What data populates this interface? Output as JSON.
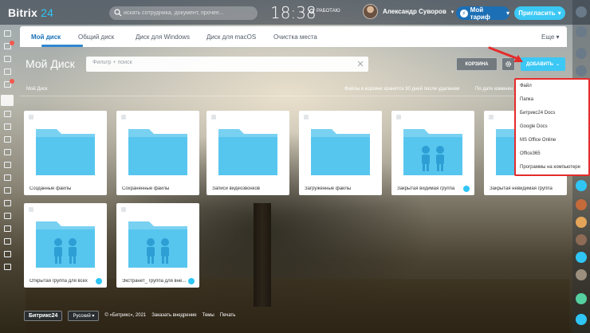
{
  "header": {
    "logo_word": "Bitrix",
    "logo_num": "24",
    "search_placeholder": "искать сотрудника, документ, прочее...",
    "clock": "18:38",
    "status": "РАБОТАЮ",
    "user_name": "Александр Суворов",
    "tariff_label": "Мой тариф",
    "invite_label": "Пригласить"
  },
  "tabs": [
    {
      "label": "Мой диск"
    },
    {
      "label": "Общий диск"
    },
    {
      "label": "Диск для Windows"
    },
    {
      "label": "Диск для macOS"
    },
    {
      "label": "Очистка места"
    }
  ],
  "more_label": "Еще",
  "toolbar": {
    "title": "Мой Диск",
    "filter_placeholder": "Фильтр + поиск",
    "trash_label": "КОРЗИНА",
    "add_label": "ДОБАВИТЬ"
  },
  "breadcrumb": "Мой Диск",
  "trash_note": "Файлы в корзине хранятся 30 дней после удаления",
  "sort_label": "По дате изменен",
  "folders": [
    {
      "name": "Созданные файлы",
      "group": false,
      "shared": false
    },
    {
      "name": "Сохраненные файлы",
      "group": false,
      "shared": false
    },
    {
      "name": "Записи видеозвонков",
      "group": false,
      "shared": false
    },
    {
      "name": "Загруженные файлы",
      "group": false,
      "shared": false
    },
    {
      "name": "Закрытая видимая группа",
      "group": true,
      "shared": true
    },
    {
      "name": "Закрытая невидимая группа",
      "group": true,
      "shared": false
    },
    {
      "name": "Открытая группа для всех",
      "group": true,
      "shared": true
    },
    {
      "name": "Экстранет_ группа для вне...",
      "group": true,
      "shared": true
    }
  ],
  "dropdown": [
    {
      "label": "Файл",
      "submenu": false
    },
    {
      "label": "Папка",
      "submenu": false
    },
    {
      "label": "Битрикс24 Docs",
      "submenu": true
    },
    {
      "label": "Google Docs",
      "submenu": true
    },
    {
      "label": "MS Office Online",
      "submenu": true
    },
    {
      "label": "Office365",
      "submenu": true
    },
    {
      "label": "Программы на компьютере",
      "submenu": true
    }
  ],
  "footer": {
    "brand": "Битрикс24",
    "language": "Русский",
    "copyright": "© «Битрикс», 2021",
    "order_link": "Заказать внедрение",
    "themes_link": "Темы",
    "print_link": "Печать"
  },
  "colors": {
    "accent": "#3bc8f5",
    "folder": "#57c6ef",
    "highlight": "#e52b2b"
  }
}
